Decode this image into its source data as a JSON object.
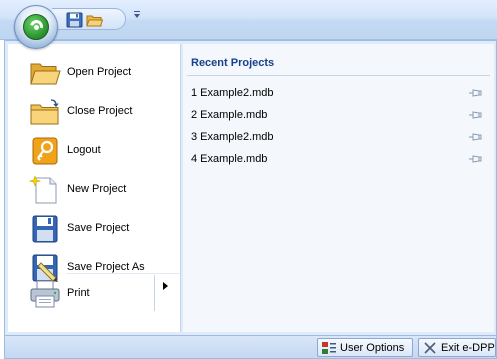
{
  "quick_access": {
    "buttons": [
      {
        "name": "save-icon"
      },
      {
        "name": "open-folder-icon"
      }
    ],
    "customize_glyph": "≡"
  },
  "menu": {
    "items": [
      {
        "label": "Open Project",
        "icon": "open-folder-icon"
      },
      {
        "label": "Close Project",
        "icon": "close-folder-icon"
      },
      {
        "label": "Logout",
        "icon": "key-icon"
      },
      {
        "label": "New Project",
        "icon": "new-document-icon"
      },
      {
        "label": "Save Project",
        "icon": "floppy-disk-icon"
      },
      {
        "label": "Save Project As",
        "icon": "save-as-icon"
      },
      {
        "label": "Print",
        "icon": "printer-icon",
        "has_submenu": true
      }
    ]
  },
  "recent": {
    "title": "Recent Projects",
    "items": [
      {
        "label": "1 Example2.mdb"
      },
      {
        "label": "2 Example.mdb"
      },
      {
        "label": "3 Example2.mdb"
      },
      {
        "label": "4 Example.mdb"
      }
    ]
  },
  "footer": {
    "user_options_label": "User Options",
    "exit_label": "Exit e-DPP"
  },
  "colors": {
    "accent": "#15428b",
    "menu_bg": "#dfeafa",
    "border": "#9ebbe1"
  }
}
